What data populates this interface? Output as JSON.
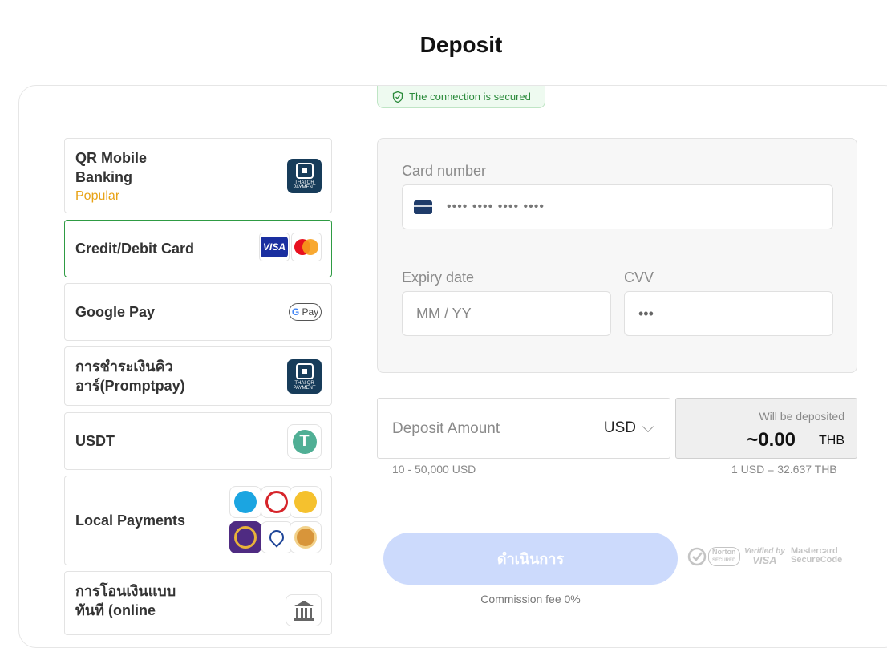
{
  "page": {
    "title": "Deposit"
  },
  "security": {
    "connection_text": "The connection is secured"
  },
  "methods": [
    {
      "label": "QR Mobile Banking",
      "label_line1": "QR Mobile",
      "label_line2": "Banking",
      "sub": "Popular",
      "icon": "thai-qr-payment-icon",
      "icon_text": "THAI QR PAYMENT"
    },
    {
      "label": "Credit/Debit Card",
      "icon": "visa-mastercard-icons",
      "visa_text": "VISA",
      "selected": true
    },
    {
      "label": "Google Pay",
      "icon": "gpay-icon",
      "g_text": "G",
      "pay_text": "Pay"
    },
    {
      "label_line1": "การชำระเงินคิว",
      "label_line2": "อาร์(Promptpay)",
      "icon": "thai-qr-payment-icon",
      "icon_text": "THAI QR PAYMENT"
    },
    {
      "label": "USDT",
      "icon": "tether-icon",
      "symbol": "T"
    },
    {
      "label": "Local Payments",
      "icon": "bank-logos-grid"
    },
    {
      "label_line1": "การโอนเงินแบบ",
      "label_line2": "ทันที (online",
      "icon": "bank-building-icon"
    }
  ],
  "card_form": {
    "card_number_label": "Card number",
    "card_number_placeholder": "•••• •••• •••• ••••",
    "expiry_label": "Expiry date",
    "expiry_placeholder": "MM / YY",
    "cvv_label": "CVV",
    "cvv_placeholder": "•••"
  },
  "amount": {
    "label": "Deposit Amount",
    "currency": "USD",
    "range_hint": "10 - 50,000 USD"
  },
  "deposit_preview": {
    "will_be_deposited_label": "Will be deposited",
    "value": "~0.00",
    "currency": "THB",
    "rate": "1 USD = 32.637 THB"
  },
  "actions": {
    "proceed_label": "ดำเนินการ",
    "commission": "Commission fee 0%"
  },
  "trust_seals": {
    "norton": "Norton",
    "norton_sub": "SECURED",
    "visa_verified_line1": "Verified by",
    "visa_verified_line2": "VISA",
    "mastercard_line1": "Mastercard",
    "mastercard_line2": "SecureCode"
  },
  "colors": {
    "accent_green": "#2e9b43",
    "popular": "#e8a317",
    "button_disabled": "#ccdafc"
  }
}
